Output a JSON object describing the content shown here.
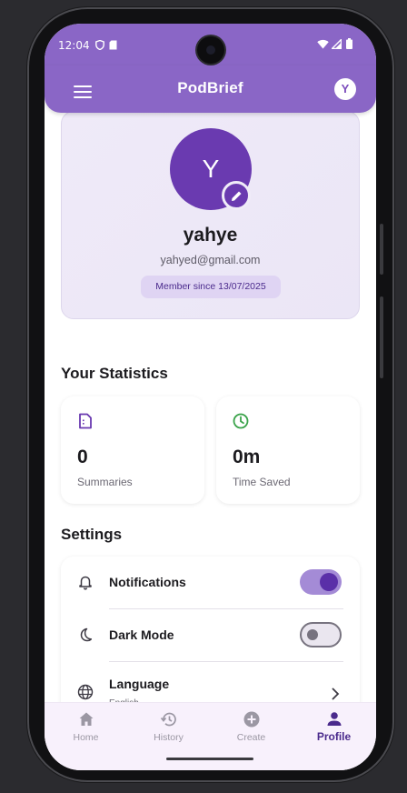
{
  "status_bar": {
    "time": "12:04"
  },
  "app_bar": {
    "title": "PodBrief",
    "avatar_initial": "Y"
  },
  "profile": {
    "avatar_initial": "Y",
    "name": "yahye",
    "email": "yahyed@gmail.com",
    "member_since": "Member since 13/07/2025"
  },
  "statistics": {
    "heading": "Your Statistics",
    "cards": [
      {
        "value": "0",
        "label": "Summaries",
        "icon": "document-icon",
        "color": "#6a3ab0"
      },
      {
        "value": "0m",
        "label": "Time Saved",
        "icon": "clock-icon",
        "color": "#3aa34a"
      }
    ]
  },
  "settings": {
    "heading": "Settings",
    "items": [
      {
        "label": "Notifications",
        "icon": "bell-icon",
        "type": "toggle",
        "on": true
      },
      {
        "label": "Dark Mode",
        "icon": "moon-icon",
        "type": "toggle",
        "on": false
      },
      {
        "label": "Language",
        "sublabel": "English",
        "icon": "globe-icon",
        "type": "link"
      }
    ]
  },
  "bottom_nav": {
    "items": [
      {
        "label": "Home",
        "icon": "home-icon",
        "active": false
      },
      {
        "label": "History",
        "icon": "history-icon",
        "active": false
      },
      {
        "label": "Create",
        "icon": "add-circle-icon",
        "active": false
      },
      {
        "label": "Profile",
        "icon": "person-icon",
        "active": true
      }
    ]
  },
  "colors": {
    "primary": "#8a66c6",
    "primary_dark": "#6a3ab0",
    "accent_green": "#3aa34a"
  }
}
